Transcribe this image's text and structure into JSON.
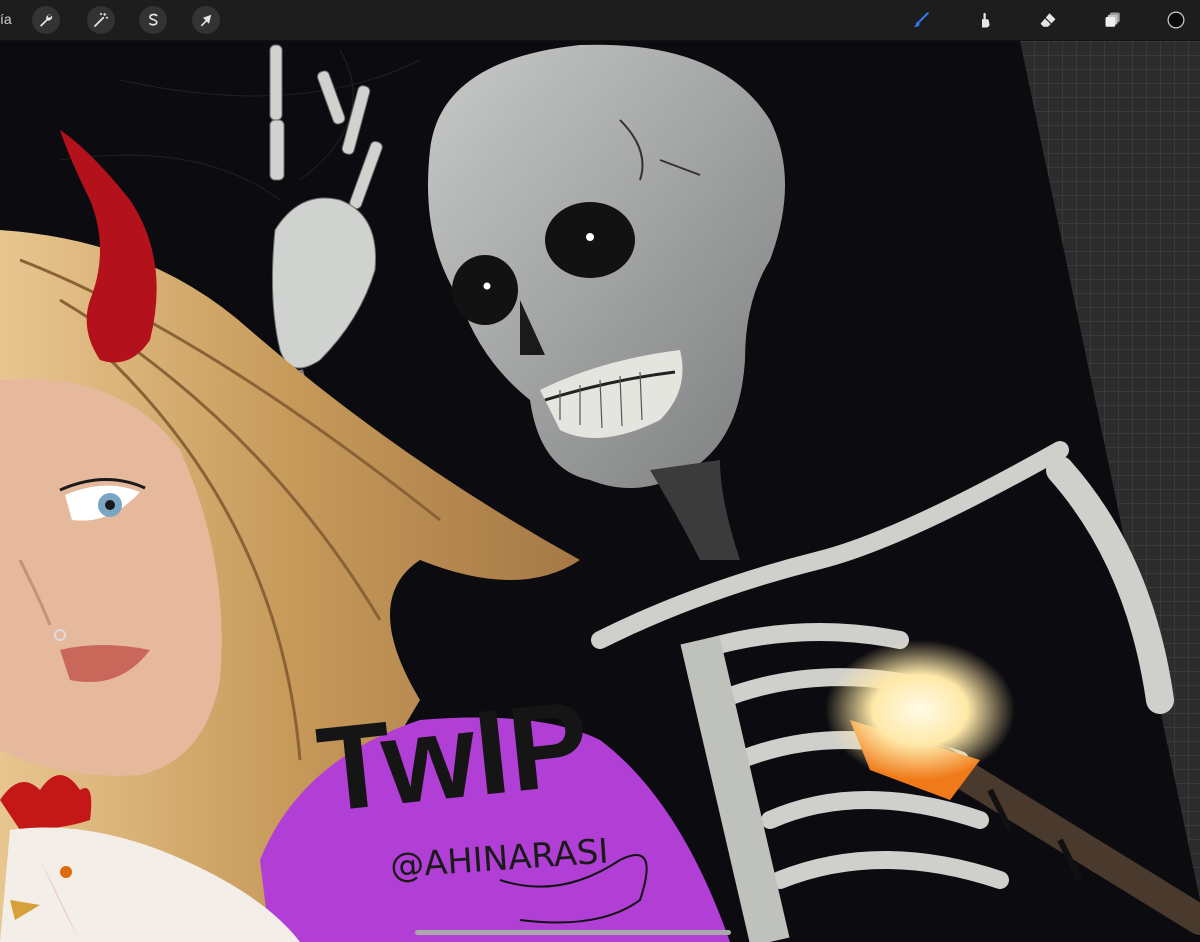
{
  "toolbar": {
    "gallery_label": "ía",
    "left_tools": [
      {
        "name": "actions",
        "icon": "wrench-icon"
      },
      {
        "name": "adjustments",
        "icon": "magic-wand-icon"
      },
      {
        "name": "selection",
        "icon": "selection-s-icon"
      },
      {
        "name": "transform",
        "icon": "arrow-cursor-icon"
      }
    ],
    "right_tools": [
      {
        "name": "brush",
        "icon": "brush-icon",
        "active": true
      },
      {
        "name": "smudge",
        "icon": "smudge-finger-icon"
      },
      {
        "name": "eraser",
        "icon": "eraser-icon"
      },
      {
        "name": "layers",
        "icon": "layers-icon"
      },
      {
        "name": "color",
        "icon": "color-swatch-icon"
      }
    ],
    "accent_color": "#2f7bf5",
    "current_color": "#0a0a0a"
  },
  "canvas": {
    "sketch_text": "TwIP",
    "signature": "@AHINARASI",
    "colors": {
      "background": "#0c0b0f",
      "shirt": "#b13fd6",
      "hair": "#d8b27a",
      "horn": "#b3121c",
      "bone": "#d6d6d2",
      "torch_flame": "#ffe9a8",
      "torch_orange": "#f07a1a"
    }
  }
}
